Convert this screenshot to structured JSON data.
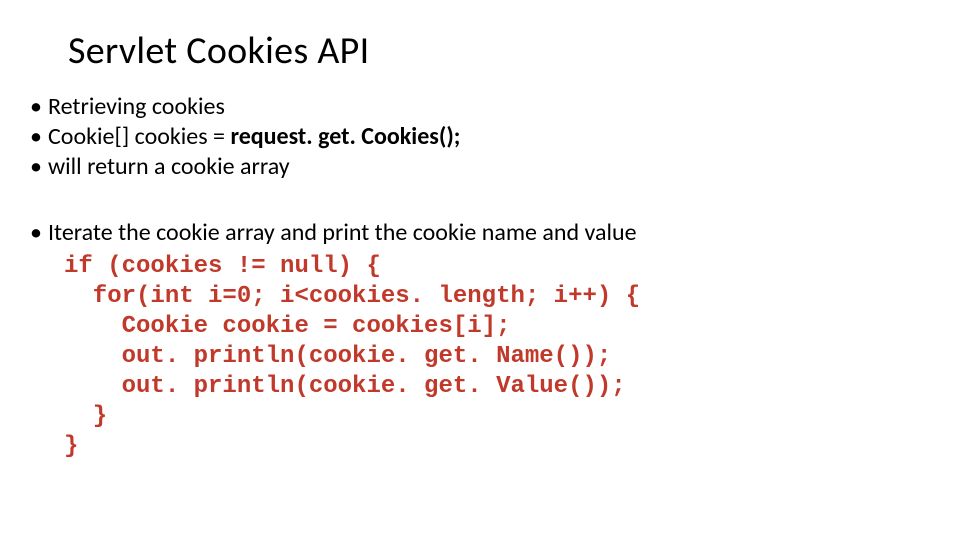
{
  "title": "Servlet Cookies API",
  "section1": {
    "heading": "Retrieving cookies",
    "line1_prefix": "Cookie[] cookies = ",
    "line1_bold": "request. get. Cookies();",
    "line2": "will return a cookie array"
  },
  "section2": {
    "heading": "Iterate the cookie array and print the cookie name and value",
    "code": "if (cookies != null) {\n  for(int i=0; i<cookies. length; i++) {\n    Cookie cookie = cookies[i];\n    out. println(cookie. get. Name());\n    out. println(cookie. get. Value());\n  }\n}"
  }
}
